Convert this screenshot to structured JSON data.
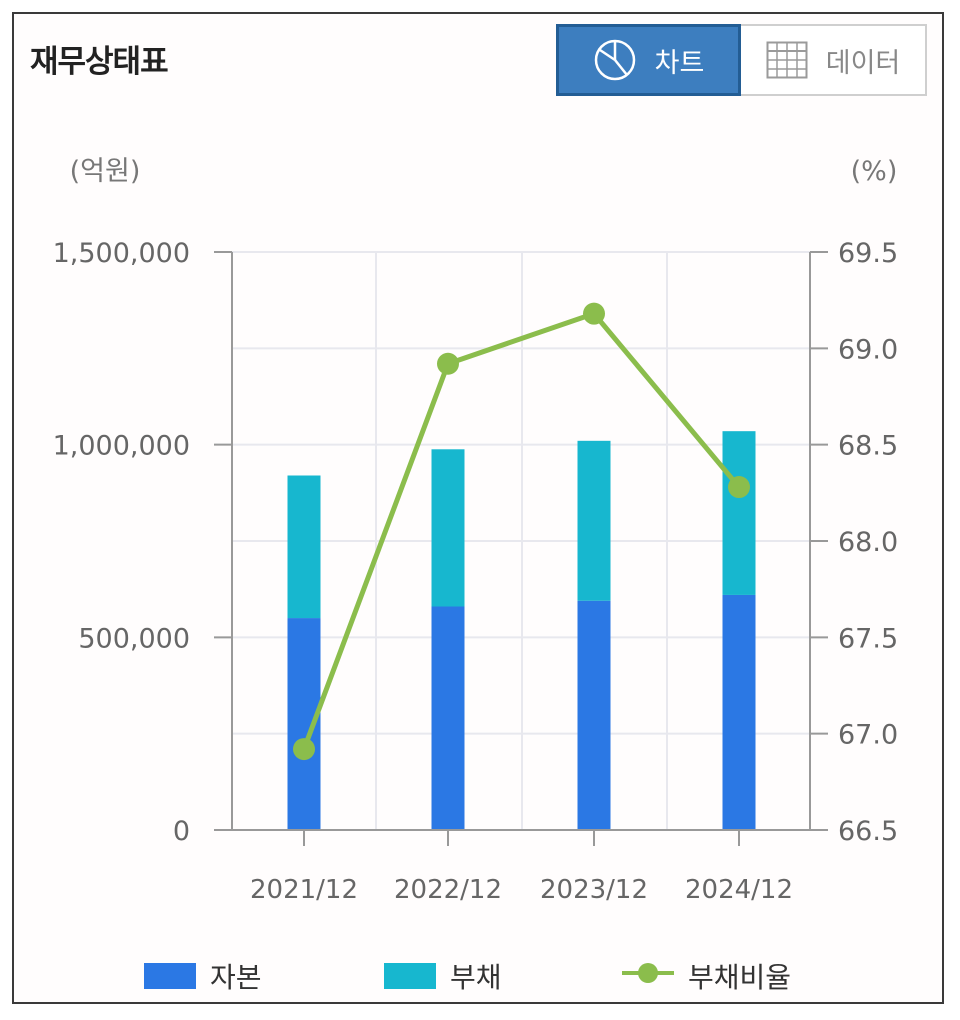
{
  "header": {
    "title": "재무상태표",
    "chart_button": "차트",
    "data_button": "데이터"
  },
  "icons": {
    "chart_button": "pie-chart-icon",
    "data_button": "table-grid-icon"
  },
  "colors": {
    "capital": "#2b78e4",
    "debt": "#17b7cf",
    "ratio_line": "#8bbd4c",
    "active_button": "#3d7ebf",
    "axis": "#999999",
    "grid": "#e8e8ee"
  },
  "chart_data": {
    "type": "bar",
    "stacked": true,
    "categories": [
      "2021/12",
      "2022/12",
      "2023/12",
      "2024/12"
    ],
    "series": [
      {
        "name": "자본",
        "type": "bar",
        "axis": "left",
        "values": [
          550000,
          580000,
          595000,
          610000
        ]
      },
      {
        "name": "부채",
        "type": "bar",
        "axis": "left",
        "values": [
          370000,
          408000,
          415000,
          425000
        ]
      },
      {
        "name": "부채비율",
        "type": "line",
        "axis": "right",
        "values": [
          66.92,
          68.92,
          69.18,
          68.28
        ]
      }
    ],
    "left_axis": {
      "unit_label": "(억원)",
      "ylim": [
        0,
        1500000
      ],
      "ticks": [
        0,
        500000,
        1000000,
        1500000
      ],
      "tick_labels": [
        "0",
        "500,000",
        "1,000,000",
        "1,500,000"
      ]
    },
    "right_axis": {
      "unit_label": "(%)",
      "ylim": [
        66.5,
        69.5
      ],
      "ticks": [
        66.5,
        67.0,
        67.5,
        68.0,
        68.5,
        69.0,
        69.5
      ],
      "tick_labels": [
        "66.5",
        "67.0",
        "67.5",
        "68.0",
        "68.5",
        "69.0",
        "69.5"
      ]
    },
    "grid": true,
    "legend": [
      "자본",
      "부채",
      "부채비율"
    ],
    "legend_position": "bottom"
  }
}
